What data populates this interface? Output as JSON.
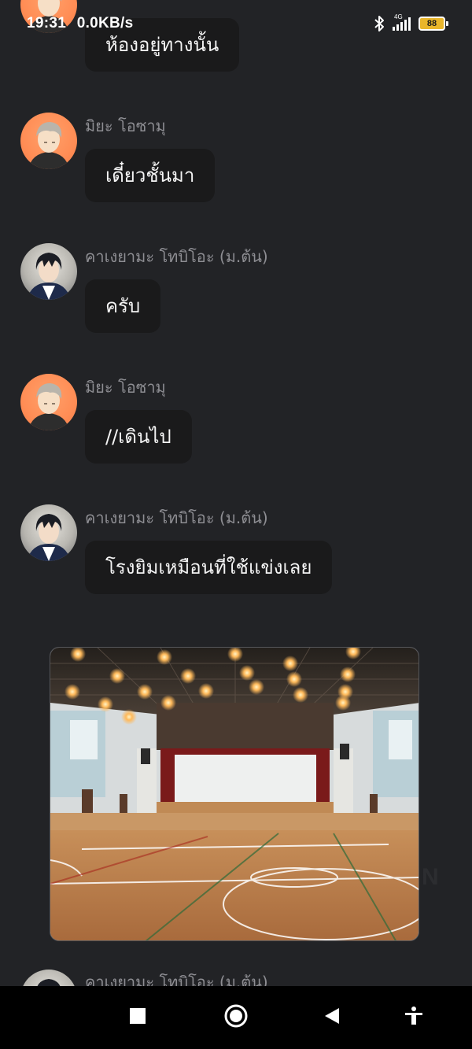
{
  "status_bar": {
    "time": "19:31",
    "network_speed": "0.0KB/s",
    "network_type": "4G",
    "battery_level": "88",
    "icons": [
      "bluetooth-icon",
      "signal-icon",
      "battery-icon"
    ]
  },
  "messages": [
    {
      "sender": "",
      "text": "ห้องอยู่ทางนั้น",
      "avatar": "miya-osamu-avatar"
    },
    {
      "sender": "มิยะ โอซามุ",
      "text": "เดี๋ยวชั้นมา",
      "avatar": "miya-osamu-avatar"
    },
    {
      "sender": "คาเงยามะ โทบิโอะ (ม.ต้น)",
      "text": "ครับ",
      "avatar": "kageyama-tobio-avatar"
    },
    {
      "sender": "มิยะ โอซามุ",
      "text": "//เดินไป",
      "avatar": "miya-osamu-avatar"
    },
    {
      "sender": "คาเงยามะ โทบิโอะ (ม.ต้น)",
      "text": "โรงยิมเหมือนที่ใช้แข่งเลย",
      "avatar": "kageyama-tobio-avatar"
    },
    {
      "sender": "คาเงยามะ โทบิโอะ (ม.ต้น)",
      "text": "",
      "avatar": "kageyama-tobio-avatar"
    }
  ],
  "image_message": {
    "description_icon": "gymnasium-image"
  },
  "nav_bar": {
    "icons": [
      "recents-square-icon",
      "home-circle-icon",
      "back-triangle-icon",
      "accessibility-icon"
    ]
  },
  "colors": {
    "background": "#222326",
    "bubble": "#1a1a1b",
    "sender_text": "#8e8e93",
    "battery": "#e9b62b"
  }
}
